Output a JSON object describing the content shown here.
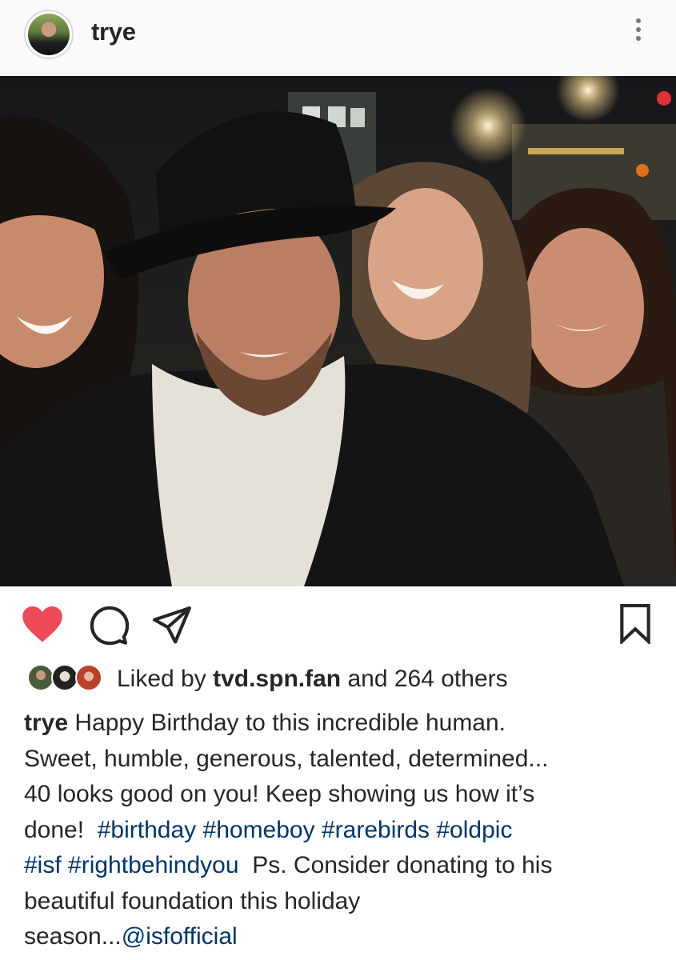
{
  "post": {
    "username": "trye",
    "likes": {
      "prefix": "Liked by",
      "top_liker": "tvd.spn.fan",
      "and": "and",
      "others": "264 others"
    },
    "caption": {
      "author": "trye",
      "line1": "Happy Birthday to this incredible human.",
      "line2": "Sweet, humble, generous, talented, determined...",
      "line3": "40 looks good on you!  Keep showing us how it’s",
      "line4_text": "done!",
      "line4_tags": [
        "#birthday",
        "#homeboy",
        "#rarebirds",
        "#oldpic"
      ],
      "line5_tags": [
        "#isf",
        "#rightbehindyou"
      ],
      "line5_text": "Ps. Consider donating to his",
      "line6": "beautiful foundation this holiday",
      "line7_text": "season...",
      "mention": "@isfofficial"
    }
  },
  "icons": {
    "more": "more-options-icon",
    "like": "heart-icon",
    "comment": "comment-icon",
    "share": "share-icon",
    "save": "bookmark-icon"
  },
  "colors": {
    "liked_heart": "#ed4956",
    "hashtag": "#003569",
    "text": "#262626",
    "header_bg": "#fafafa"
  }
}
